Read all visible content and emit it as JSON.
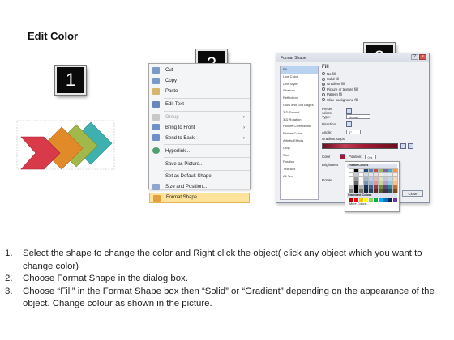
{
  "title": "Edit Color",
  "steps": [
    "1",
    "2",
    "3"
  ],
  "context_menu": {
    "items": [
      {
        "label": "Cut",
        "icon": "scissors-icon",
        "color": "#7b9bc7"
      },
      {
        "label": "Copy",
        "icon": "copy-icon",
        "color": "#7b9bc7"
      },
      {
        "label": "Paste",
        "icon": "paste-icon",
        "color": "#d7b56a"
      },
      {
        "label": "Edit Text",
        "icon": "edit-text-icon",
        "color": "#6a86b6"
      },
      {
        "label": "Group",
        "icon": "group-icon",
        "color": "#c8c8c8",
        "disabled": true,
        "submenu": true
      },
      {
        "label": "Bring to Front",
        "icon": "bring-front-icon",
        "color": "#6f8fc8",
        "submenu": true
      },
      {
        "label": "Send to Back",
        "icon": "send-back-icon",
        "color": "#6f8fc8",
        "submenu": true
      },
      {
        "label": "Hyperlink...",
        "icon": "hyperlink-icon",
        "color": "#4f9f6f"
      },
      {
        "label": "Save as Picture...",
        "icon": "",
        "color": ""
      },
      {
        "label": "Set as Default Shape",
        "icon": "",
        "color": ""
      },
      {
        "label": "Size and Position...",
        "icon": "size-position-icon",
        "color": "#8fa7cc"
      },
      {
        "label": "Format Shape...",
        "icon": "format-shape-icon",
        "color": "#e0a040",
        "active": true
      }
    ]
  },
  "format_dialog": {
    "title": "Format Shape",
    "categories": [
      "Fill",
      "Line Color",
      "Line Style",
      "Shadow",
      "Reflection",
      "Glow and Soft Edges",
      "3-D Format",
      "3-D Rotation",
      "Picture Corrections",
      "Picture Color",
      "Artistic Effects",
      "Crop",
      "Size",
      "Position",
      "Text Box",
      "Alt Text"
    ],
    "selected_category": "Fill",
    "heading": "Fill",
    "fill_options": [
      "No fill",
      "Solid fill",
      "Gradient fill",
      "Picture or texture fill",
      "Pattern fill",
      "Slide background fill"
    ],
    "selected_fill": "Gradient fill",
    "fields": {
      "preset_colors_label": "Preset colors:",
      "type_label": "Type:",
      "type_value": "Linear",
      "direction_label": "Direction:",
      "angle_label": "Angle:",
      "angle_value": "0°",
      "gradient_stops_label": "Gradient stops",
      "color_label": "Color",
      "position_label": "Position:",
      "position_value": "0%",
      "brightness_label": "Brightness",
      "rotate_label": "Rotate",
      "close_label": "Close"
    },
    "color_popup": {
      "theme_label": "Theme Colors",
      "standard_label": "Standard Colors",
      "more_label": "More Colors..."
    }
  },
  "theme_palette": [
    "#ffffff",
    "#000000",
    "#eeece1",
    "#1f497d",
    "#4f81bd",
    "#c0504d",
    "#9bbb59",
    "#8064a2",
    "#4bacc6",
    "#f79646"
  ],
  "standard_palette": [
    "#c00000",
    "#ff0000",
    "#ffc000",
    "#ffff00",
    "#92d050",
    "#00b050",
    "#00b0f0",
    "#0070c0",
    "#002060",
    "#7030a0"
  ],
  "instructions": [
    {
      "num": "1.",
      "text": "Select the shape to change the color and Right click the object( click any object which you want to change color)"
    },
    {
      "num": "2.",
      "text": "Choose Format Shape in the dialog box."
    },
    {
      "num": "3.",
      "text": "Choose “Fill” in the Format Shape box then “Solid” or “Gradient” depending on the appearance of the object. Change colour as shown in the picture."
    }
  ]
}
